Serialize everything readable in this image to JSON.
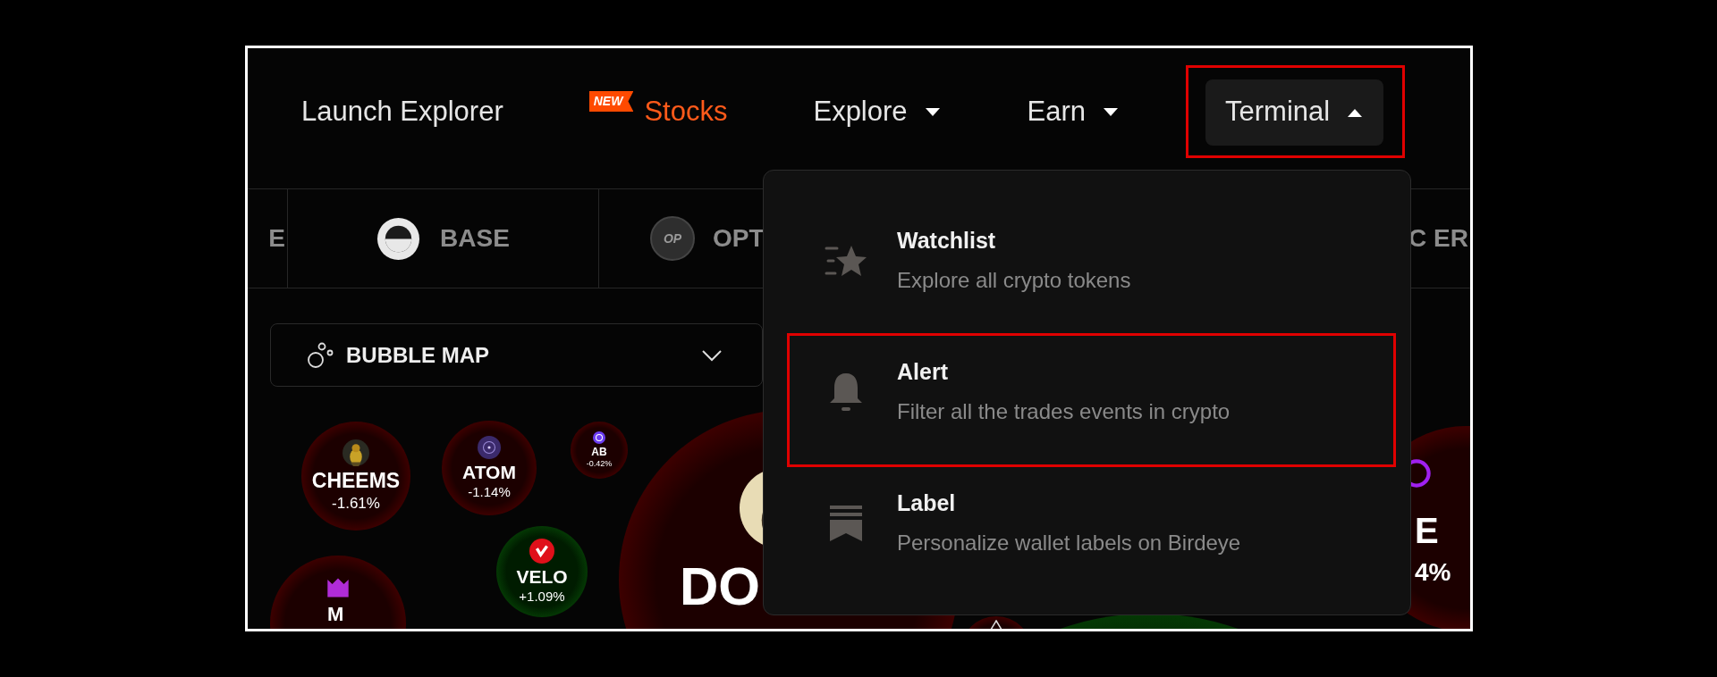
{
  "nav": [
    {
      "label": "Launch Explorer",
      "kind": "link"
    },
    {
      "label": "Stocks",
      "kind": "featured",
      "badge": "NEW"
    },
    {
      "label": "Explore",
      "kind": "menu",
      "expanded": false,
      "highlighted": false
    },
    {
      "label": "Earn",
      "kind": "menu",
      "expanded": false,
      "highlighted": false
    },
    {
      "label": "Terminal",
      "kind": "menu",
      "expanded": true,
      "highlighted": true,
      "menu_items": [
        {
          "title": "Watchlist",
          "description": "Explore all crypto tokens",
          "kind": "star",
          "highlighted": false
        },
        {
          "title": "Alert",
          "description": "Filter all the trades events in crypto",
          "kind": "bell",
          "highlighted": true
        },
        {
          "title": "Label",
          "description": "Personalize wallet labels on Birdeye",
          "kind": "bookmark",
          "highlighted": false
        }
      ]
    }
  ],
  "chains": [
    {
      "label": "E",
      "kind": "plain"
    },
    {
      "label": "BASE",
      "kind": "base"
    },
    {
      "label": "OPT",
      "kind": "op",
      "icon_text": "OP"
    },
    {
      "label": "C ER",
      "kind": "plain"
    }
  ],
  "view_select": {
    "label": "BUBBLE MAP"
  },
  "bubbles": [
    {
      "label": "CHEEMS",
      "change": "-1.61%",
      "kind": "down"
    },
    {
      "label": "ATOM",
      "change": "-1.14%",
      "kind": "down"
    },
    {
      "label": "AB",
      "change": "-0.42%",
      "kind": "down"
    },
    {
      "label": "DO",
      "kind": "down"
    },
    {
      "label": "E",
      "change": "4%",
      "kind": "down"
    },
    {
      "label": "VELO",
      "change": "+1.09%",
      "kind": "up"
    },
    {
      "label": "M",
      "kind": "down"
    },
    {
      "kind": "down"
    },
    {
      "kind": "up"
    }
  ]
}
